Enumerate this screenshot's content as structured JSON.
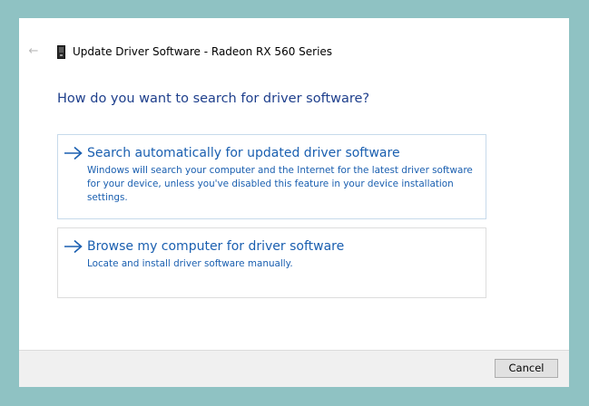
{
  "window": {
    "title": "Update Driver Software - Radeon RX 560 Series",
    "back_icon": "back-arrow-icon",
    "device_icon": "device-icon"
  },
  "main": {
    "heading": "How do you want to search for driver software?",
    "options": [
      {
        "title": "Search automatically for updated driver software",
        "description": "Windows will search your computer and the Internet for the latest driver software for your device, unless you've disabled this feature in your device installation settings.",
        "icon": "arrow-right-icon"
      },
      {
        "title": "Browse my computer for driver software",
        "description": "Locate and install driver software manually.",
        "icon": "arrow-right-icon"
      }
    ]
  },
  "footer": {
    "cancel_label": "Cancel"
  },
  "colors": {
    "desktop": "#8fc2c3",
    "heading": "#1e3f8c",
    "link": "#1a5fb0",
    "option_border": "#c7daeb"
  }
}
